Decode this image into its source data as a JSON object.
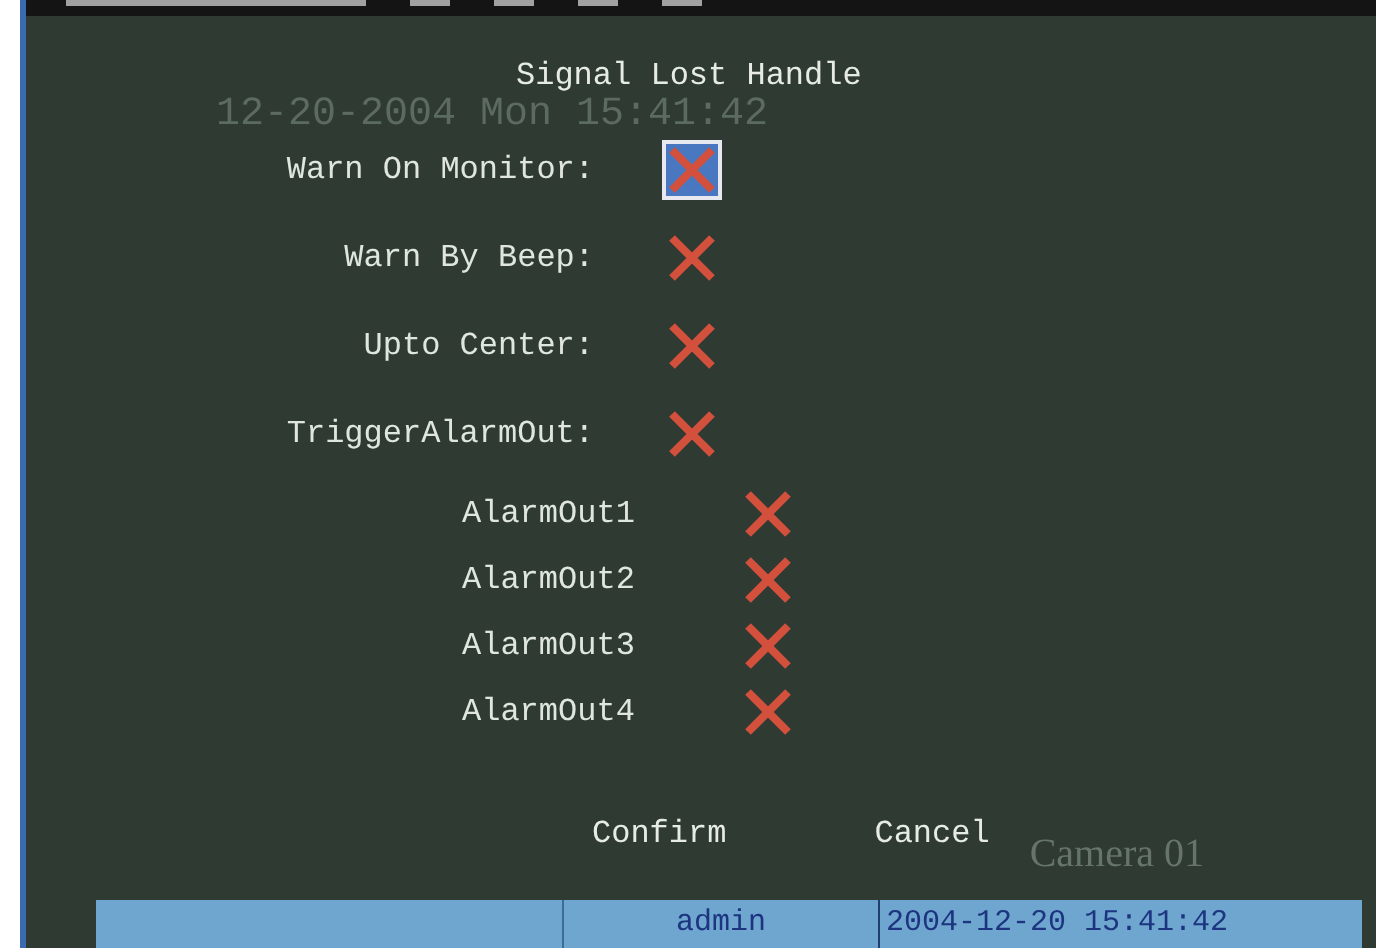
{
  "title": "Signal Lost Handle",
  "overlay_datetime": "12-20-2004 Mon 15:41:42",
  "options": [
    {
      "label": "Warn On Monitor:",
      "checked": false,
      "focused": true
    },
    {
      "label": "Warn By Beep:",
      "checked": false,
      "focused": false
    },
    {
      "label": "Upto Center:",
      "checked": false,
      "focused": false
    },
    {
      "label": "TriggerAlarmOut:",
      "checked": false,
      "focused": false
    }
  ],
  "alarm_outputs": [
    {
      "label": "AlarmOut1",
      "checked": false
    },
    {
      "label": "AlarmOut2",
      "checked": false
    },
    {
      "label": "AlarmOut3",
      "checked": false
    },
    {
      "label": "AlarmOut4",
      "checked": false
    }
  ],
  "buttons": [
    "Confirm",
    "Cancel"
  ],
  "camera_label": "Camera 01",
  "status_bar": {
    "user": "admin",
    "datetime": "2004-12-20 15:41:42"
  }
}
